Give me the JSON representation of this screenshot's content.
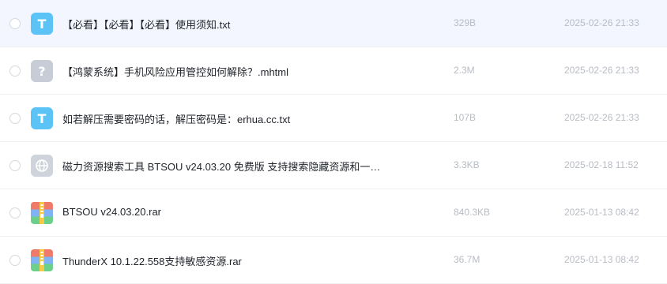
{
  "files": [
    {
      "name": "【必看】【必看】【必看】使用须知.txt",
      "size": "329B",
      "date": "2025-02-26 21:33",
      "icon": "txt-file-icon",
      "icon_letter": "T"
    },
    {
      "name": "【鸿蒙系统】手机风险应用管控如何解除？.mhtml",
      "size": "2.3M",
      "date": "2025-02-26 21:33",
      "icon": "unknown-file-icon",
      "icon_letter": "?"
    },
    {
      "name": "如若解压需要密码的话，解压密码是：erhua.cc.txt",
      "size": "107B",
      "date": "2025-02-26 21:33",
      "icon": "txt-file-icon",
      "icon_letter": "T"
    },
    {
      "name": "磁力资源搜索工具 BTSOU v24.03.20 免费版 支持搜索隐藏资源和一…",
      "size": "3.3KB",
      "date": "2025-02-18 11:52",
      "icon": "link-file-icon",
      "icon_letter": ""
    },
    {
      "name": "BTSOU v24.03.20.rar",
      "size": "840.3KB",
      "date": "2025-01-13 08:42",
      "icon": "rar-archive-icon",
      "icon_letter": ""
    },
    {
      "name": "ThunderX 10.1.22.558支持敏感资源.rar",
      "size": "36.7M",
      "date": "2025-01-13 08:42",
      "icon": "rar-archive-icon",
      "icon_letter": ""
    }
  ],
  "colors": {
    "txt_icon": "#5bc3f5",
    "unknown_icon": "#c8ccd6",
    "highlight_row": "#f3f6ff",
    "meta_text": "#b8bcc4"
  }
}
